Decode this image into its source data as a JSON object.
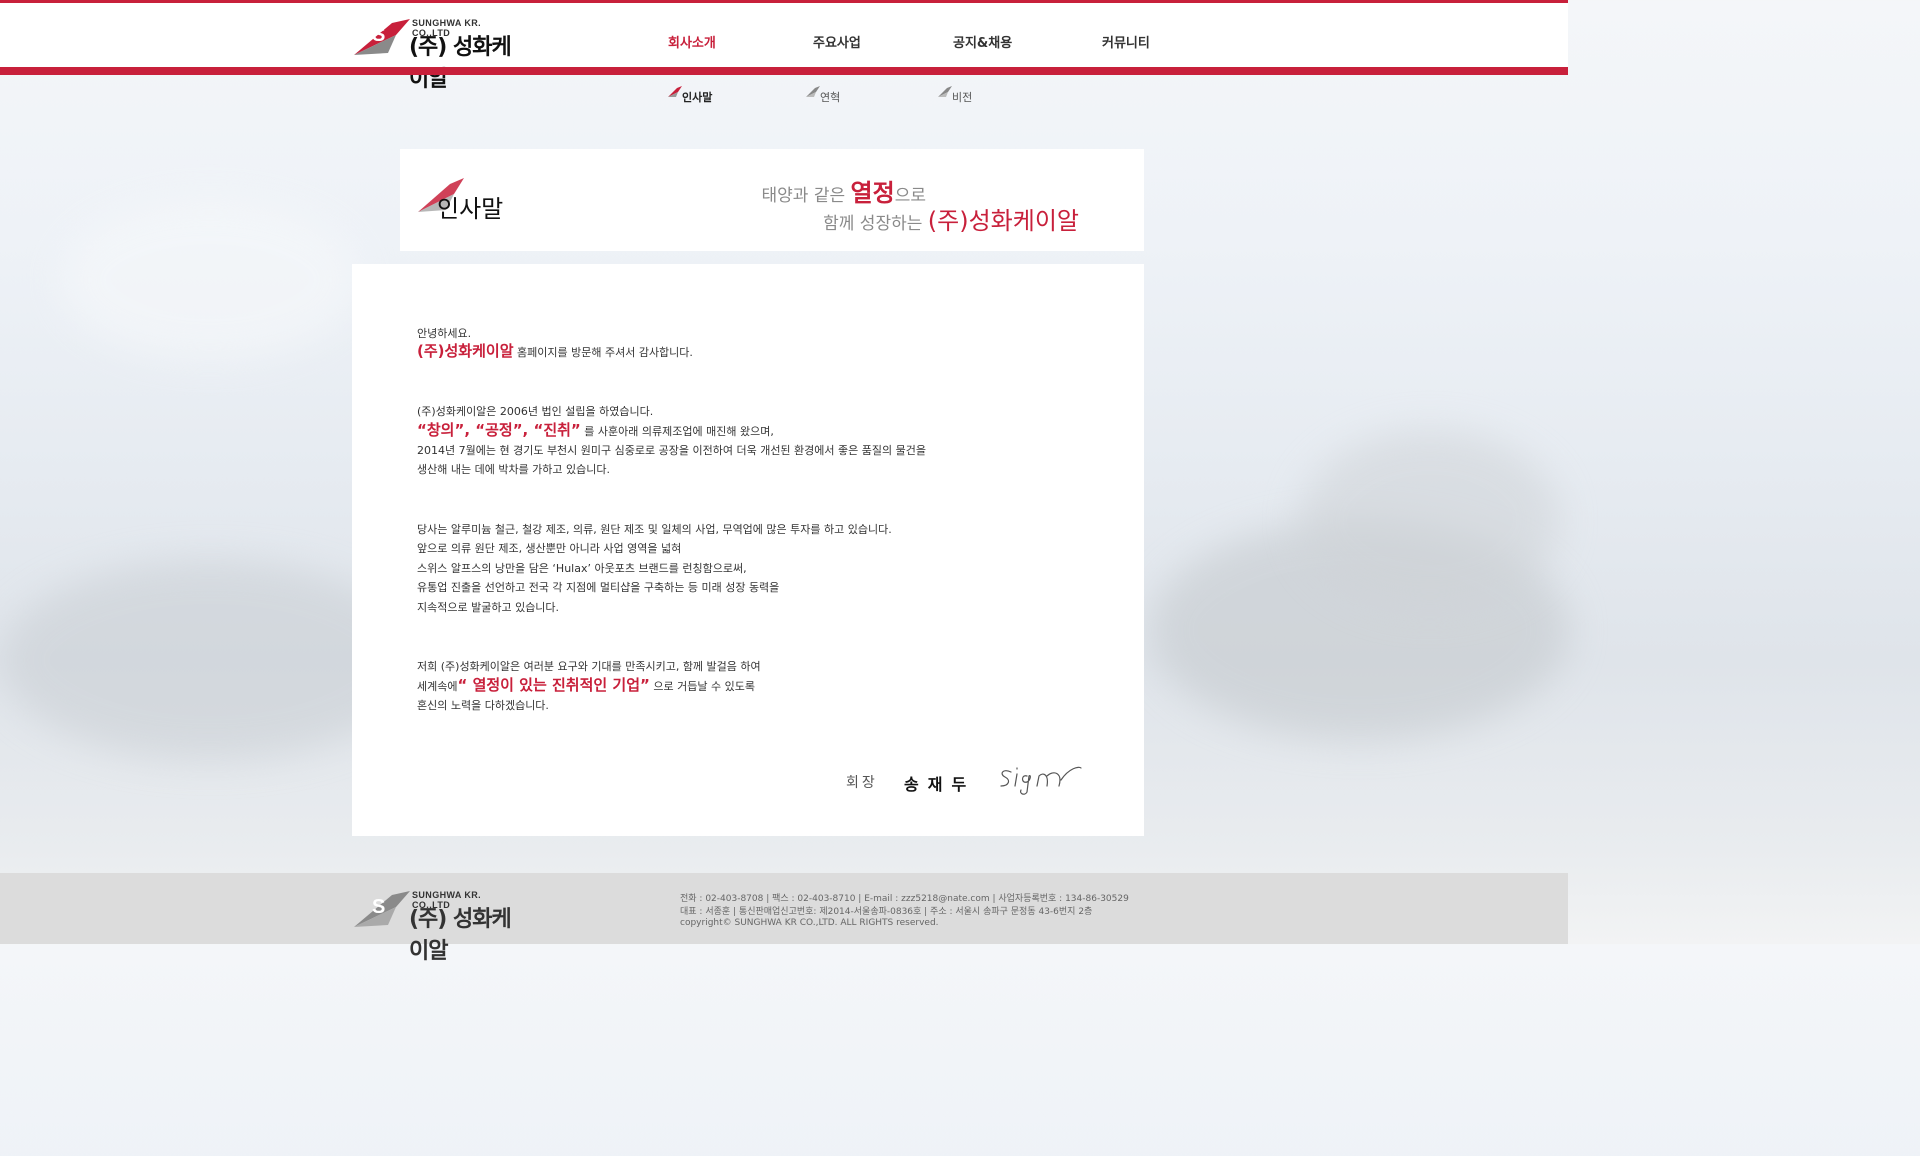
{
  "header": {
    "logo_en": "SUNGHWA KR. CO.,LTD",
    "logo_ko": "(주) 성화케이알"
  },
  "nav": {
    "items": [
      {
        "label": "회사소개",
        "active": true
      },
      {
        "label": "주요사업",
        "active": false
      },
      {
        "label": "공지&채용",
        "active": false
      },
      {
        "label": "커뮤니티",
        "active": false
      }
    ]
  },
  "subnav": {
    "items": [
      {
        "label": "인사말",
        "active": true
      },
      {
        "label": "연혁",
        "active": false
      },
      {
        "label": "비전",
        "active": false
      }
    ]
  },
  "title": {
    "page_title": "인사말",
    "slogan1_pre": "태양과 같은 ",
    "slogan1_hl": "열정",
    "slogan1_post": "으로",
    "slogan2_pre": "함께 성장하는 ",
    "slogan2_hl": "(주)성화케이알"
  },
  "greeting": {
    "line1": "안녕하세요.",
    "line2_hl": "(주)성화케이알",
    "line2_rest": " 홈페이지를 방문해 주셔서 감사합니다.",
    "line3": "(주)성화케이알은 2006년 법인 설립을 하였습니다.",
    "line4_hl": "“창의”, “공정”, “진취”",
    "line4_rest": " 를 사훈아래 의류제조업에 매진해 왔으며,",
    "line5": "2014년 7월에는 현 경기도 부천시 원미구 심중로로 공장을 이전하여 더욱 개선된 환경에서 좋은 품질의 물건을",
    "line6": " 생산해 내는 데에 박차를 가하고 있습니다.",
    "line7": "당사는 알루미늄 철근, 철강 제조, 의류, 원단 제조 및 일체의 사업, 무역업에 많은 투자를 하고 있습니다.",
    "line8": "앞으로 의류 원단 제조, 생산뿐만 아니라 사업 영역을 넓혀",
    "line9": "스위스 알프스의 낭만을 담은 ‘Hulax’ 아웃포츠 브랜드를 런칭함으로써,",
    "line10": "유통업 진출을 선언하고 전국 각 지점에 멀티샵을 구축하는 등 미래 성장 동력을",
    "line11": "지속적으로 발굴하고 있습니다.",
    "line12": "저희 (주)성화케이알은 여러분 요구와 기대를 만족시키고, 함께 발걸음 하여",
    "line13_pre": "세계속에",
    "line13_hl": "“ 열정이 있는 진취적인 기업”",
    "line13_rest": " 으로 거듭날  수 있도록",
    "line14": "혼신의 노력을 다하겠습니다."
  },
  "signature": {
    "title": "회장",
    "name": "송재두",
    "sign_text": "Sign"
  },
  "footer": {
    "logo_en": "SUNGHWA KR. CO.,LTD",
    "logo_ko": "(주) 성화케이알",
    "info1": "전화 : 02-403-8708  |  팩스 : 02-403-8710   |   E-mail : zzz5218@nate.com  | 사업자등록번호 : 134-86-30529",
    "info2": "대표 : 서종훈  |   통신판매업신고번호: 제2014-서울송파-0836호   |   주소 : 서울시 송파구 문정동 43-6번지 2층",
    "info3": "copyright© SUNGHWA KR CO.,LTD. ALL RIGHTS reserved."
  },
  "colors": {
    "accent": "#c8203b"
  }
}
